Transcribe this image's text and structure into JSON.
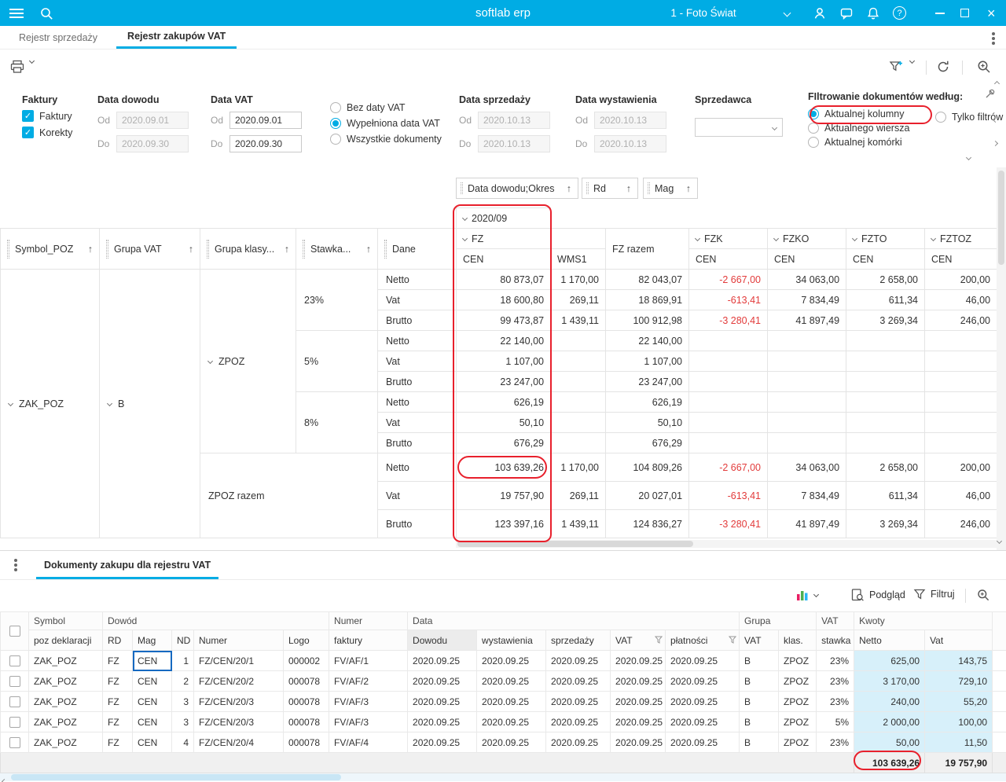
{
  "icons": {
    "sort_asc": "↑",
    "check": "✓",
    "close": "×",
    "help": "?"
  },
  "topbar": {
    "title": "softlab erp",
    "company": "1 - Foto Świat"
  },
  "tabs": [
    "Rejestr sprzedaży",
    "Rejestr zakupów VAT"
  ],
  "filters": {
    "faktury": {
      "title": "Faktury",
      "options": [
        {
          "label": "Faktury",
          "checked": true
        },
        {
          "label": "Korekty",
          "checked": true
        }
      ]
    },
    "data_dowodu": {
      "title": "Data dowodu",
      "od_label": "Od",
      "do_label": "Do",
      "od_value": "2020.09.01",
      "do_value": "2020.09.30"
    },
    "data_vat": {
      "title": "Data VAT",
      "od_label": "Od",
      "do_label": "Do",
      "od_value": "2020.09.01",
      "do_value": "2020.09.30"
    },
    "vat_mode": {
      "options": [
        {
          "label": "Bez daty VAT",
          "selected": false
        },
        {
          "label": "Wypełniona data VAT",
          "selected": true
        },
        {
          "label": "Wszystkie dokumenty",
          "selected": false
        }
      ]
    },
    "data_sprzedazy": {
      "title": "Data sprzedaży",
      "od_label": "Od",
      "do_label": "Do",
      "od_value": "2020.10.13",
      "do_value": "2020.10.13"
    },
    "data_wystawienia": {
      "title": "Data wystawienia",
      "od_label": "Od",
      "do_label": "Do",
      "od_value": "2020.10.13",
      "do_value": "2020.10.13"
    },
    "sprzedawca": {
      "title": "Sprzedawca"
    },
    "filtrowanie": {
      "title": "FIltrowanie dokumentów według:",
      "options": [
        {
          "label": "Aktualnej kolumny",
          "selected": true
        },
        {
          "label": "Tylko filtrów",
          "selected": false
        },
        {
          "label": "Aktualnego wiersza",
          "selected": false
        },
        {
          "label": "Aktualnej komórki",
          "selected": false
        }
      ]
    }
  },
  "pivot": {
    "field_chips": [
      "Data dowodu;Okres",
      "Rd",
      "Mag"
    ],
    "row_fields": [
      "Symbol_POZ",
      "Grupa VAT",
      "Grupa klasy...",
      "Stawka...",
      "Dane"
    ],
    "period": "2020/09",
    "doc_cols": [
      "FZ",
      "FZK",
      "FZKO",
      "FZTO",
      "FZTOZ"
    ],
    "fz_razem": "FZ razem",
    "mag_cols": [
      "CEN",
      "WMS1",
      "CEN",
      "CEN",
      "CEN",
      "CEN"
    ],
    "row_groups": {
      "symbol": "ZAK_POZ",
      "grupa_vat": "B",
      "grupa_klas": "ZPOZ",
      "razem": "ZPOZ razem",
      "stawki": [
        "23%",
        "5%",
        "8%"
      ]
    },
    "rows": [
      {
        "dane": "Netto",
        "values": [
          "80 873,07",
          "1 170,00",
          "82 043,07",
          "-2 667,00",
          "34 063,00",
          "2 658,00",
          "200,00"
        ]
      },
      {
        "dane": "Vat",
        "values": [
          "18 600,80",
          "269,11",
          "18 869,91",
          "-613,41",
          "7 834,49",
          "611,34",
          "46,00"
        ]
      },
      {
        "dane": "Brutto",
        "values": [
          "99 473,87",
          "1 439,11",
          "100 912,98",
          "-3 280,41",
          "41 897,49",
          "3 269,34",
          "246,00"
        ]
      },
      {
        "dane": "Netto",
        "values": [
          "22 140,00",
          "",
          "22 140,00",
          "",
          "",
          "",
          ""
        ]
      },
      {
        "dane": "Vat",
        "values": [
          "1 107,00",
          "",
          "1 107,00",
          "",
          "",
          "",
          ""
        ]
      },
      {
        "dane": "Brutto",
        "values": [
          "23 247,00",
          "",
          "23 247,00",
          "",
          "",
          "",
          ""
        ]
      },
      {
        "dane": "Netto",
        "values": [
          "626,19",
          "",
          "626,19",
          "",
          "",
          "",
          ""
        ]
      },
      {
        "dane": "Vat",
        "values": [
          "50,10",
          "",
          "50,10",
          "",
          "",
          "",
          ""
        ]
      },
      {
        "dane": "Brutto",
        "values": [
          "676,29",
          "",
          "676,29",
          "",
          "",
          "",
          ""
        ]
      },
      {
        "dane": "Netto",
        "values": [
          "103 639,26",
          "1 170,00",
          "104 809,26",
          "-2 667,00",
          "34 063,00",
          "2 658,00",
          "200,00"
        ]
      },
      {
        "dane": "Vat",
        "values": [
          "19 757,90",
          "269,11",
          "20 027,01",
          "-613,41",
          "7 834,49",
          "611,34",
          "46,00"
        ]
      },
      {
        "dane": "Brutto",
        "values": [
          "123 397,16",
          "1 439,11",
          "124 836,27",
          "-3 280,41",
          "41 897,49",
          "3 269,34",
          "246,00"
        ]
      }
    ]
  },
  "bottom": {
    "tab": "Dokumenty zakupu dla rejestru VAT",
    "toolbar": {
      "preview": "Podgląd",
      "filter": "Filtruj"
    },
    "group_headers": [
      "Symbol",
      "Dowód",
      "Numer",
      "Data",
      "Grupa",
      "VAT",
      "Kwoty"
    ],
    "columns": [
      "poz deklaracji",
      "RD",
      "Mag",
      "ND",
      "Numer",
      "Logo",
      "faktury",
      "Dowodu",
      "wystawienia",
      "sprzedaży",
      "VAT",
      "płatności",
      "VAT",
      "klas.",
      "stawka",
      "Netto",
      "Vat"
    ],
    "rows": [
      [
        "ZAK_POZ",
        "FZ",
        "CEN",
        "1",
        "FZ/CEN/20/1",
        "000002",
        "FV/AF/1",
        "2020.09.25",
        "2020.09.25",
        "2020.09.25",
        "2020.09.25",
        "2020.09.25",
        "B",
        "ZPOZ",
        "23%",
        "625,00",
        "143,75"
      ],
      [
        "ZAK_POZ",
        "FZ",
        "CEN",
        "2",
        "FZ/CEN/20/2",
        "000078",
        "FV/AF/2",
        "2020.09.25",
        "2020.09.25",
        "2020.09.25",
        "2020.09.25",
        "2020.09.25",
        "B",
        "ZPOZ",
        "23%",
        "3 170,00",
        "729,10"
      ],
      [
        "ZAK_POZ",
        "FZ",
        "CEN",
        "3",
        "FZ/CEN/20/3",
        "000078",
        "FV/AF/3",
        "2020.09.25",
        "2020.09.25",
        "2020.09.25",
        "2020.09.25",
        "2020.09.25",
        "B",
        "ZPOZ",
        "23%",
        "240,00",
        "55,20"
      ],
      [
        "ZAK_POZ",
        "FZ",
        "CEN",
        "3",
        "FZ/CEN/20/3",
        "000078",
        "FV/AF/3",
        "2020.09.25",
        "2020.09.25",
        "2020.09.25",
        "2020.09.25",
        "2020.09.25",
        "B",
        "ZPOZ",
        "5%",
        "2 000,00",
        "100,00"
      ],
      [
        "ZAK_POZ",
        "FZ",
        "CEN",
        "4",
        "FZ/CEN/20/4",
        "000078",
        "FV/AF/4",
        "2020.09.25",
        "2020.09.25",
        "2020.09.25",
        "2020.09.25",
        "2020.09.25",
        "B",
        "ZPOZ",
        "23%",
        "50,00",
        "11,50"
      ]
    ],
    "footer": {
      "netto": "103 639,26",
      "vat": "19 757,90"
    }
  }
}
